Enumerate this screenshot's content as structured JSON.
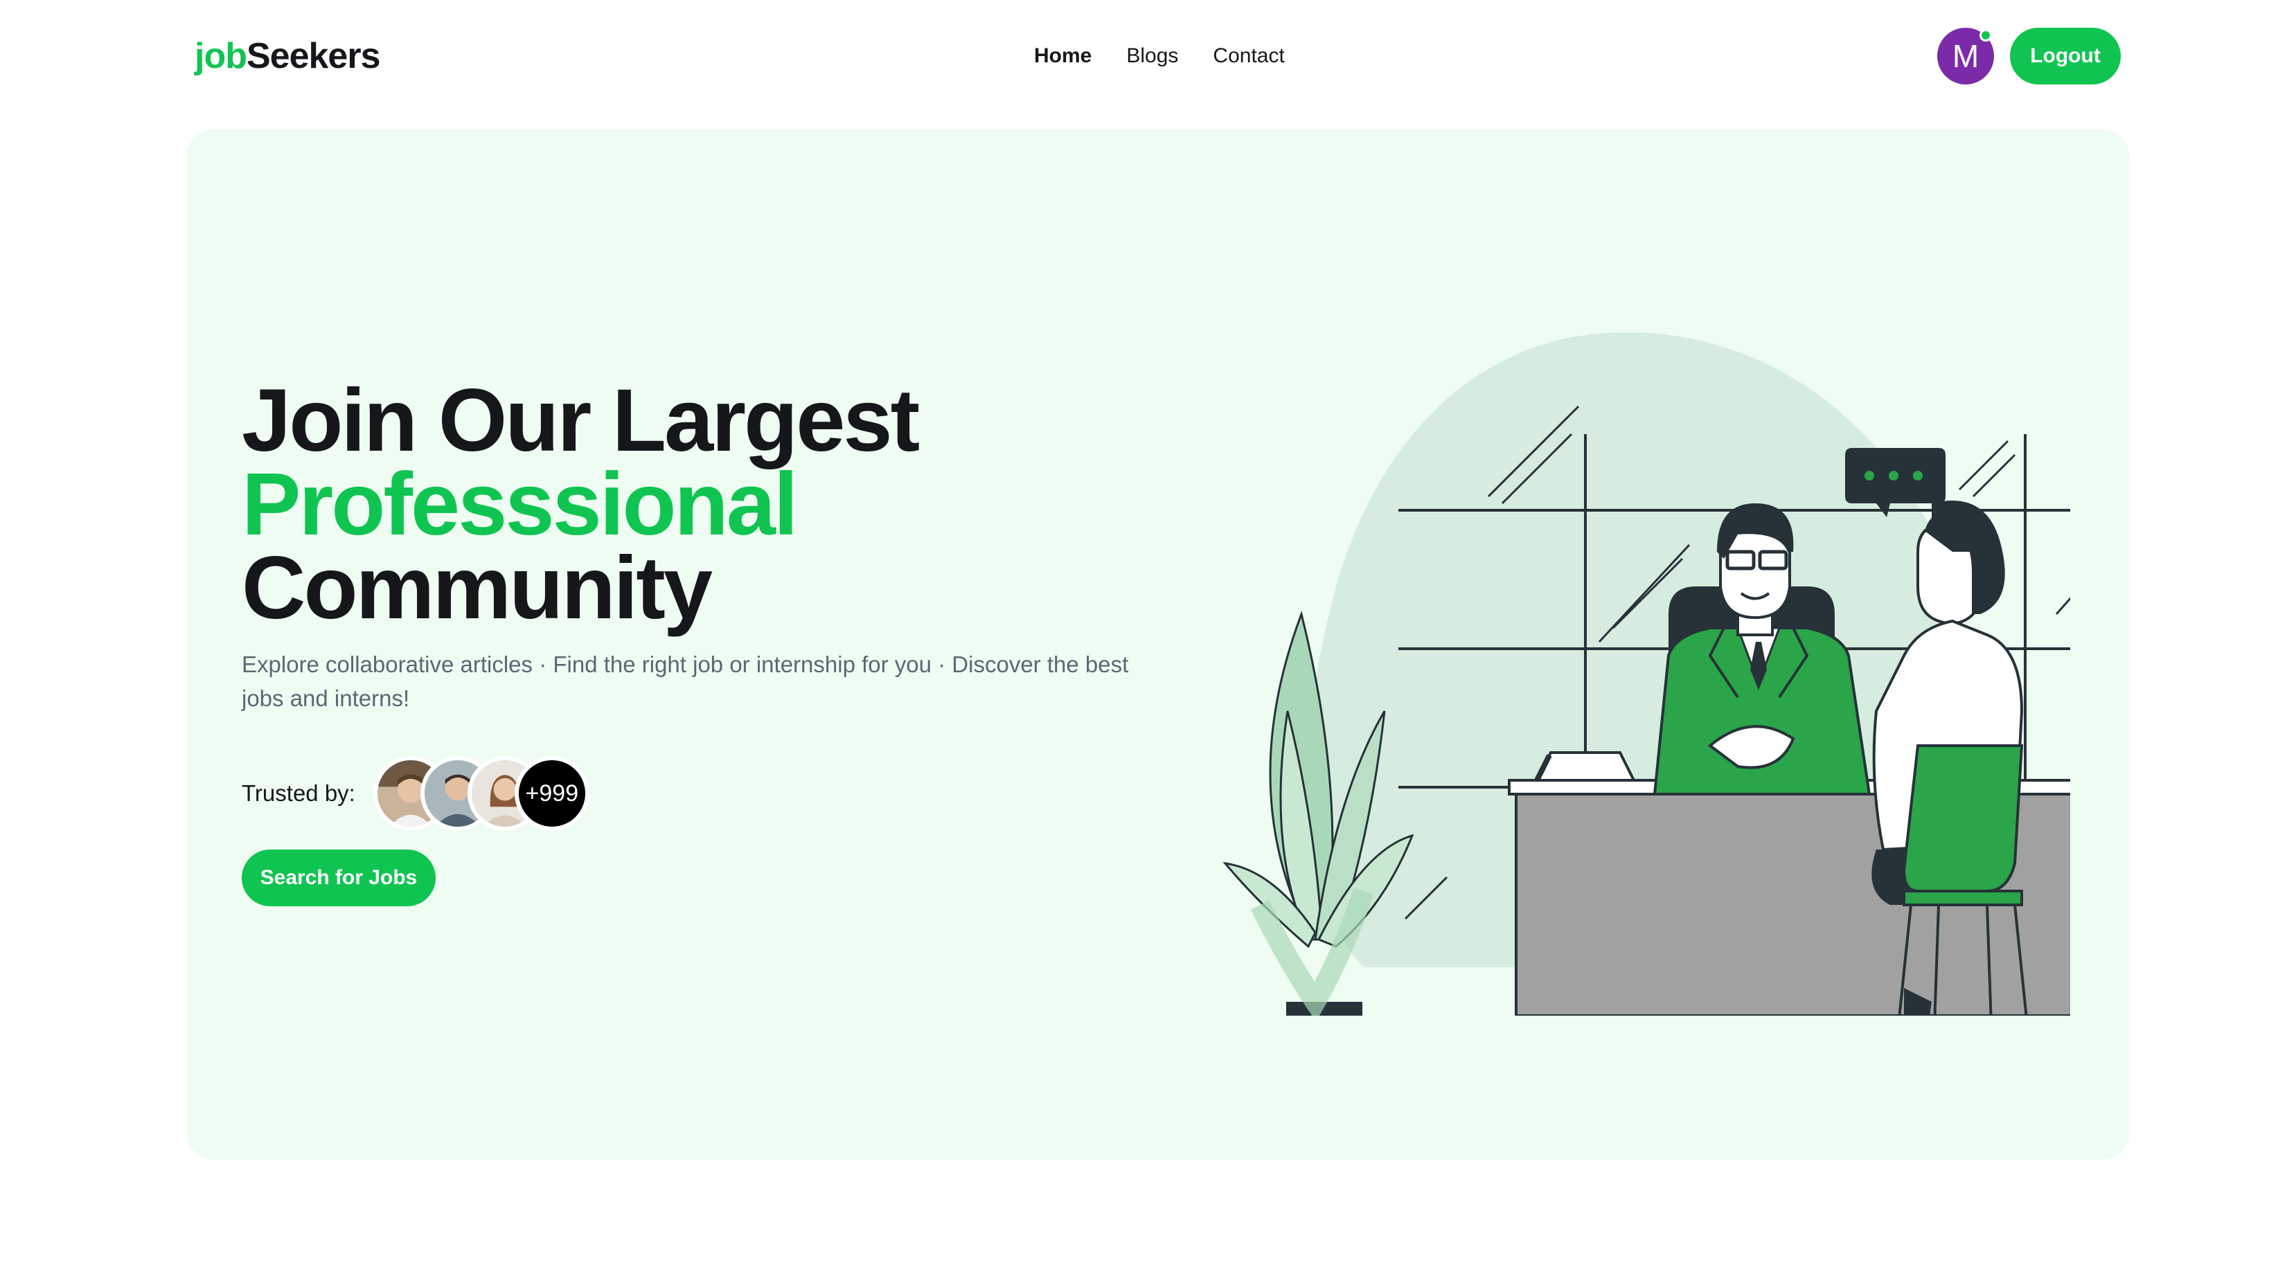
{
  "header": {
    "logo_part1": "job",
    "logo_part2": "Seekers",
    "nav": [
      {
        "label": "Home"
      },
      {
        "label": "Blogs"
      },
      {
        "label": "Contact"
      }
    ],
    "avatar_initial": "M",
    "logout_label": "Logout"
  },
  "hero": {
    "headline_line1": "Join Our Largest",
    "headline_line2": "Professsional",
    "headline_line3": "Community",
    "subtext": "Explore collaborative articles · Find the right job or internship for you · Discover the best jobs and interns!",
    "trusted_label": "Trusted by:",
    "trusted_count": "+999",
    "cta_label": "Search for Jobs"
  },
  "colors": {
    "accent": "#10c452",
    "hero_background": "#effcf2",
    "avatar": "#7b2ba8",
    "text_primary": "#15171a",
    "text_muted": "#5d6674",
    "illustration_green": "#2aa54a"
  },
  "icons": [
    "online-status-dot",
    "user-avatar",
    "chat-bubble"
  ]
}
